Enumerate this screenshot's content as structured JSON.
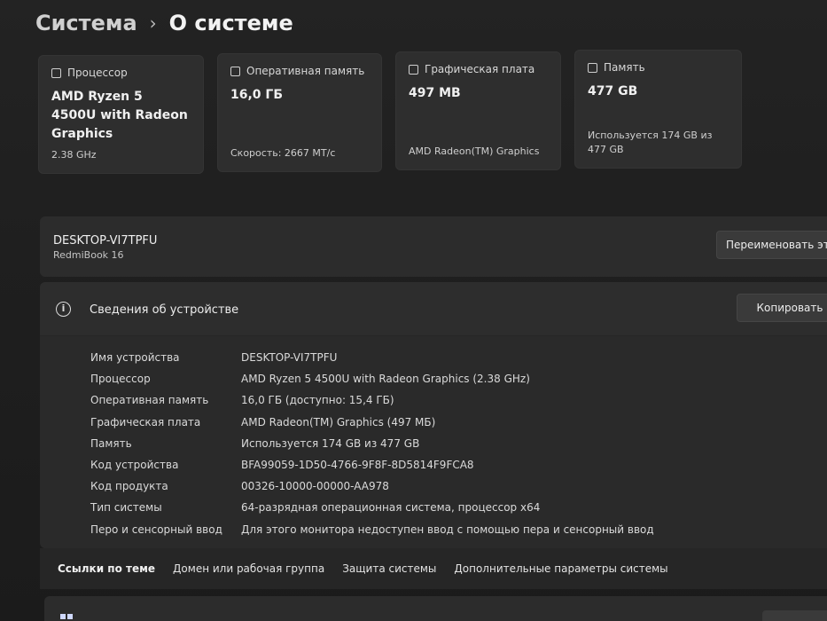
{
  "breadcrumb": {
    "root": "Система",
    "separator": "›",
    "current": "О системе"
  },
  "cards": [
    {
      "title": "Процессор",
      "value": "AMD Ryzen 5 4500U with Radeon Graphics",
      "sub": "2.38 GHz",
      "icon": "cpu-icon"
    },
    {
      "title": "Оперативная память",
      "value": "16,0 ГБ",
      "sub": "Скорость: 2667 МТ/с",
      "icon": "ram-icon"
    },
    {
      "title": "Графическая плата",
      "value": "497 MB",
      "sub": "AMD Radeon(TM) Graphics",
      "icon": "gpu-icon"
    },
    {
      "title": "Память",
      "value": "477 GB",
      "sub": "Используется 174 GB из 477 GB",
      "icon": "storage-icon"
    }
  ],
  "device": {
    "name": "DESKTOP-VI7TPFU",
    "model": "RedmiBook 16",
    "rename_label": "Переименовать эт"
  },
  "details": {
    "title": "Сведения об устройстве",
    "copy_label": "Копировать",
    "rows": [
      {
        "label": "Имя устройства",
        "value": "DESKTOP-VI7TPFU"
      },
      {
        "label": "Процессор",
        "value": "AMD Ryzen 5 4500U with Radeon Graphics (2.38 GHz)"
      },
      {
        "label": "Оперативная память",
        "value": "16,0 ГБ (доступно: 15,4 ГБ)"
      },
      {
        "label": "Графическая плата",
        "value": "AMD Radeon(TM) Graphics (497 МБ)"
      },
      {
        "label": "Память",
        "value": "Используется 174 GB из 477 GB"
      },
      {
        "label": "Код устройства",
        "value": "BFA99059-1D50-4766-9F8F-8D5814F9FCA8"
      },
      {
        "label": "Код продукта",
        "value": "00326-10000-00000-AA978"
      },
      {
        "label": "Тип системы",
        "value": "64-разрядная операционная система, процессор x64"
      },
      {
        "label": "Перо и сенсорный ввод",
        "value": "Для этого монитора недоступен ввод с помощью пера и сенсорный ввод"
      }
    ]
  },
  "related": {
    "title": "Ссылки по теме",
    "links": [
      "Домен или рабочая группа",
      "Защита системы",
      "Дополнительные параметры системы"
    ]
  }
}
